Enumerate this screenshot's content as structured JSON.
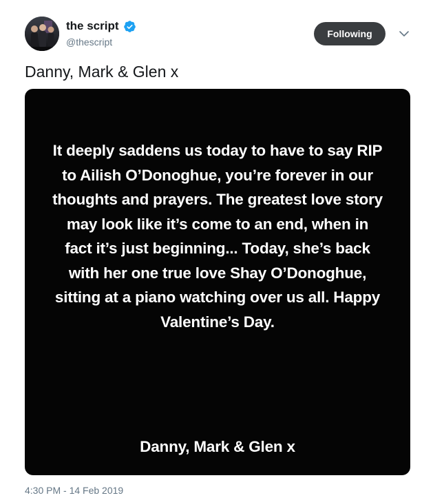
{
  "author": {
    "display_name": "the script",
    "handle": "@thescript",
    "verified": true,
    "verified_icon": "verified-badge-icon",
    "avatar_icon": "band-avatar"
  },
  "actions": {
    "follow_label": "Following",
    "more_icon": "chevron-down-icon"
  },
  "tweet": {
    "text": "Danny, Mark & Glen x",
    "image_text_body": "It deeply saddens us today to have to say RIP to Ailish O’Donoghue, you’re forever in our thoughts and prayers. The greatest love story may look like it’s come to an end, when in fact it’s just beginning... Today, she’s back with her one true love Shay O’Donoghue, sitting at a piano watching over us all. Happy Valentine’s Day.",
    "image_text_signature": "Danny, Mark & Glen x",
    "timestamp": "4:30 PM - 14 Feb 2019"
  },
  "colors": {
    "verified_blue": "#1da1f2",
    "follow_button_bg": "#3a3d40",
    "secondary_text": "#657786",
    "image_bg": "#050505"
  }
}
